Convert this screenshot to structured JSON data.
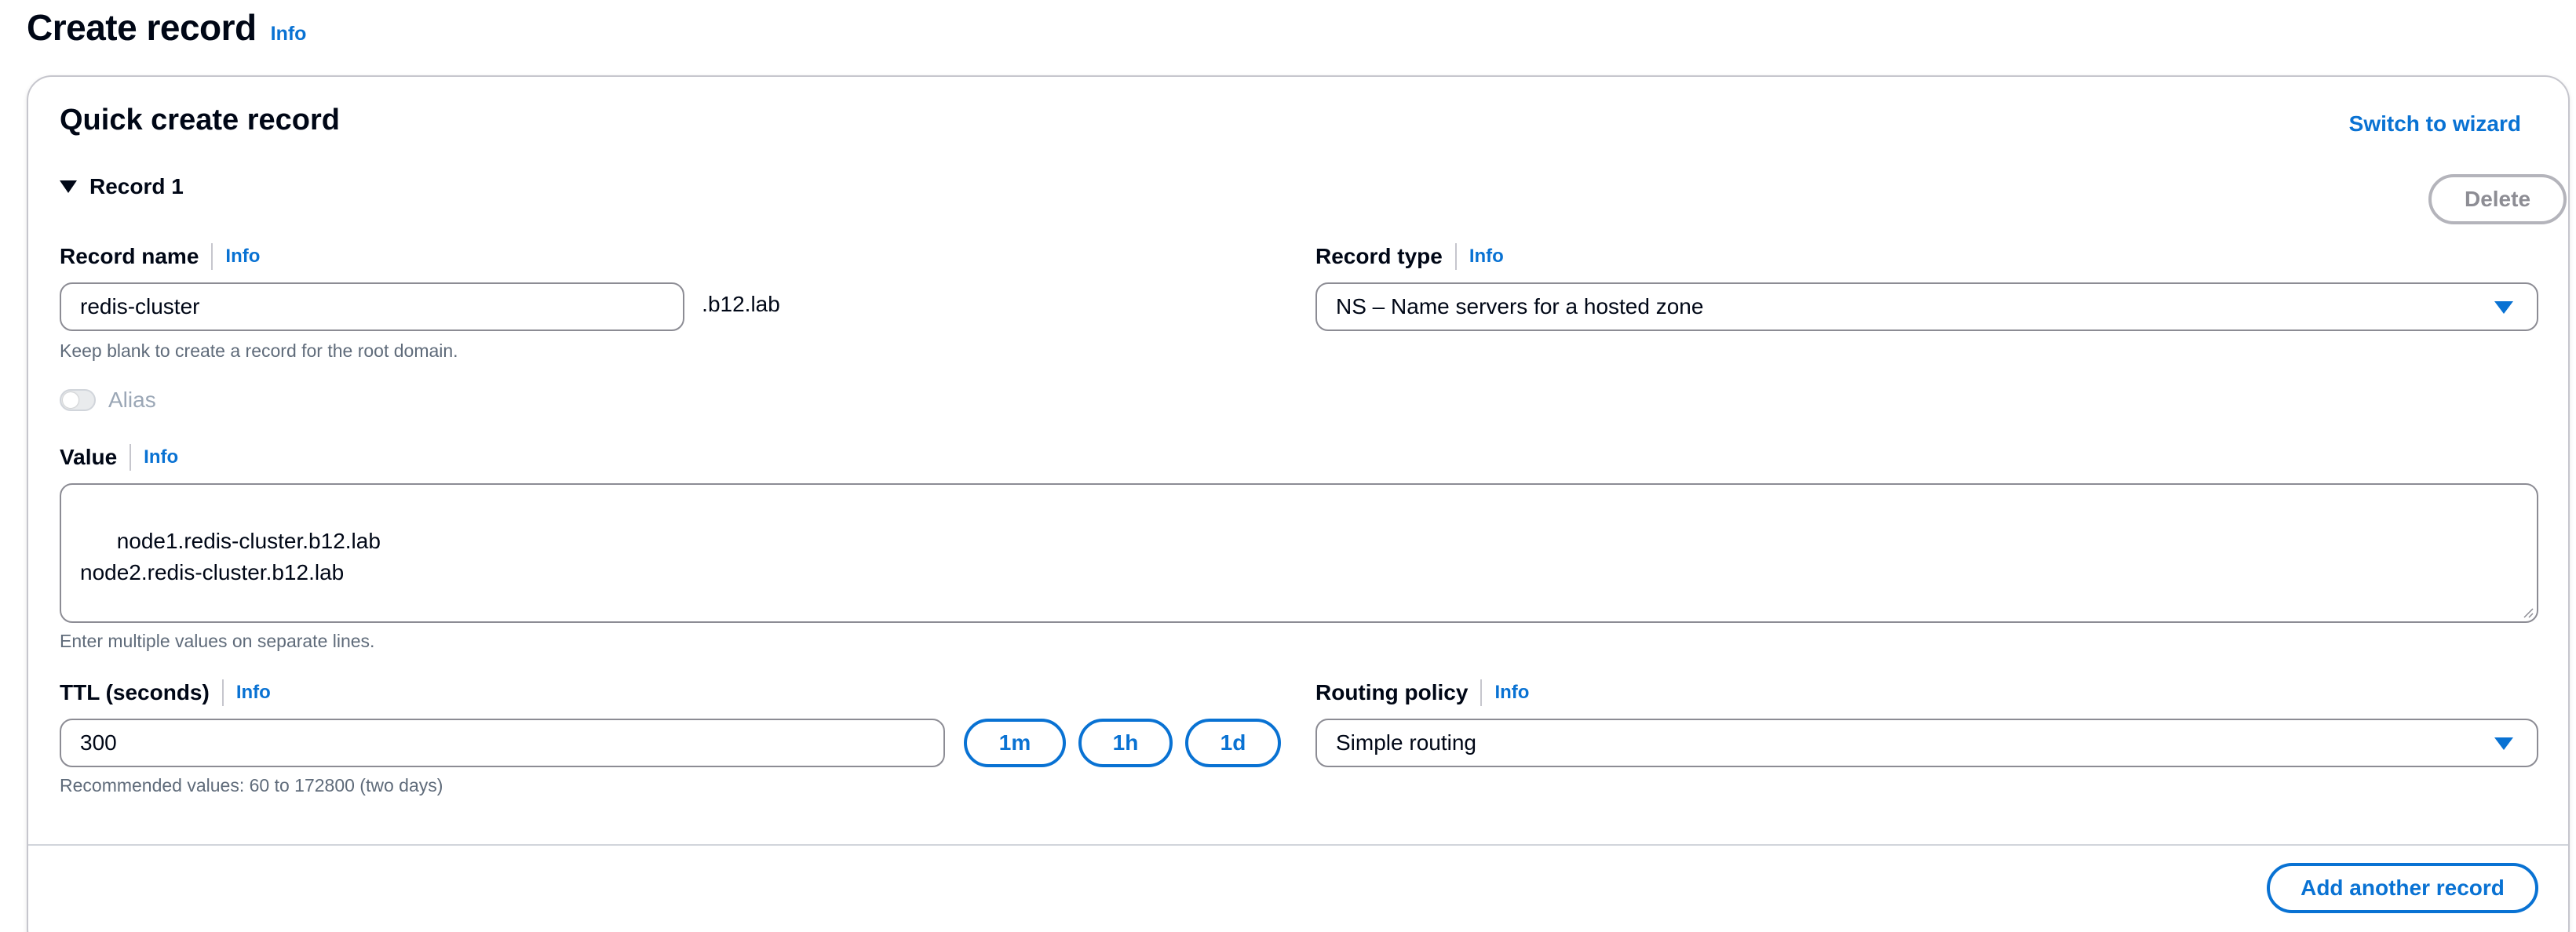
{
  "page": {
    "title": "Create record",
    "title_info": "Info"
  },
  "panel": {
    "title": "Quick create record",
    "switch_wizard": "Switch to wizard",
    "record_toggle_label": "Record 1",
    "delete_label": "Delete"
  },
  "record_name": {
    "label": "Record name",
    "info": "Info",
    "value": "redis-cluster",
    "suffix": ".b12.lab",
    "hint": "Keep blank to create a record for the root domain."
  },
  "record_type": {
    "label": "Record type",
    "info": "Info",
    "selected": "NS – Name servers for a hosted zone"
  },
  "alias": {
    "label": "Alias",
    "enabled": false
  },
  "value": {
    "label": "Value",
    "info": "Info",
    "text": "node1.redis-cluster.b12.lab\nnode2.redis-cluster.b12.lab",
    "hint": "Enter multiple values on separate lines."
  },
  "ttl": {
    "label": "TTL (seconds)",
    "info": "Info",
    "value": "300",
    "quick_1m": "1m",
    "quick_1h": "1h",
    "quick_1d": "1d",
    "hint": "Recommended values: 60 to 172800 (two days)"
  },
  "routing_policy": {
    "label": "Routing policy",
    "info": "Info",
    "selected": "Simple routing"
  },
  "footer": {
    "add_another": "Add another record"
  },
  "colors": {
    "accent": "#0972d3",
    "text": "#000716",
    "hint": "#5f6b7a",
    "border": "#8c8c94"
  },
  "icons": {
    "expand": "caret-down-filled-icon",
    "select": "caret-down-filled-icon",
    "resize": "resize-grip-icon"
  }
}
